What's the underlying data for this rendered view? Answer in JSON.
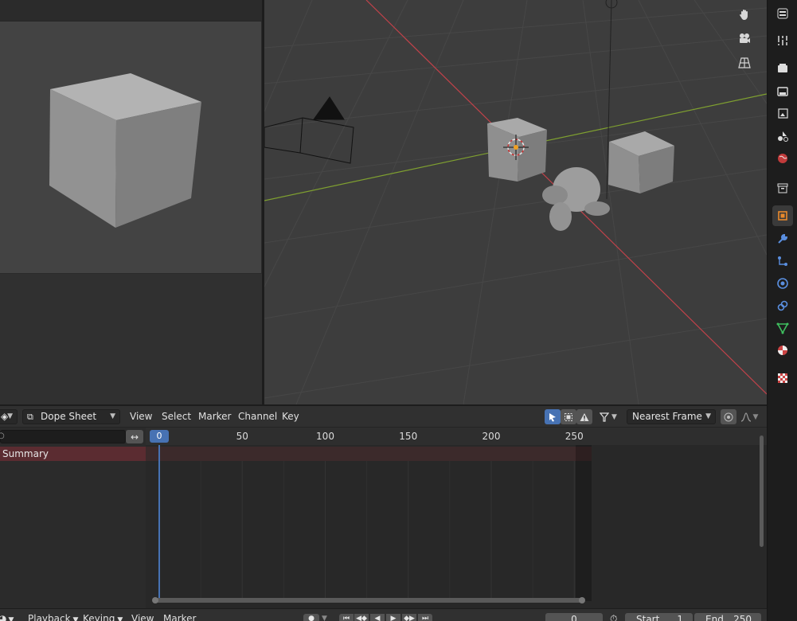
{
  "dopesheet": {
    "editor_type_icon": "dopesheet-icon",
    "mode_label": "Dope Sheet",
    "menu": {
      "view": "View",
      "select": "Select",
      "marker": "Marker",
      "channel": "Channel",
      "key": "Key"
    },
    "snapping_label": "Nearest Frame",
    "summary_label": "Summary",
    "current_frame": "0",
    "ruler_ticks": [
      {
        "frame": 50,
        "label": "50"
      },
      {
        "frame": 100,
        "label": "100"
      },
      {
        "frame": 150,
        "label": "150"
      },
      {
        "frame": 200,
        "label": "200"
      },
      {
        "frame": 250,
        "label": "250"
      }
    ]
  },
  "timeline": {
    "playback_label": "Playback",
    "keying_label": "Keying",
    "view_label": "View",
    "marker_label": "Marker",
    "current_frame": "0",
    "start_label": "Start",
    "start_value": "1",
    "end_label": "End",
    "end_value": "250"
  },
  "properties_tabs": [
    "tool-icon",
    "render-icon",
    "output-icon",
    "view-layer-icon",
    "scene-icon",
    "world-icon",
    "collection-icon",
    "object-icon",
    "modifier-icon",
    "particles-icon",
    "physics-icon",
    "constraints-icon",
    "data-icon",
    "material-icon",
    "texture-icon"
  ],
  "colors": {
    "accent_blue": "#4772b3",
    "summary_red": "#5b2c31",
    "x_axis": "#c2424a",
    "y_axis": "#7fa030",
    "active_tab": "#e8892b"
  }
}
